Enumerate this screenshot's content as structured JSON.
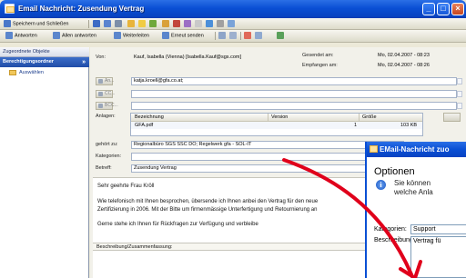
{
  "window": {
    "title": "Email Nachricht: Zusendung Vertrag",
    "minimize": "_",
    "maximize": "□",
    "close": "×"
  },
  "toolbar1": {
    "save_close": "Speichern und Schließen"
  },
  "toolbar2": {
    "reply": "Antworten",
    "reply_all": "Allen antworten",
    "forward": "Weiterleiten",
    "resend": "Erneut senden"
  },
  "nav": {
    "header": "Zugeordnete Objekte",
    "group": "Berechtigungsordner",
    "group_chevron": "»",
    "item": "Auswählen"
  },
  "header": {
    "from_label": "Von:",
    "from_value": "Kauf, Isabella (Vienna) [Isabella.Kauf@sgs.com]",
    "sent_label": "Gesendet am:",
    "sent_value": "Mo, 02.04.2007 - 08:23",
    "received_label": "Empfangen am:",
    "received_value": "Mo, 02.04.2007 - 08:26",
    "to_btn": "An...",
    "to_value": "katja.kroell@gfa.co.at;",
    "cc_btn": "CC...",
    "bcc_btn": "BCC..."
  },
  "attachments": {
    "label": "Anlagen:",
    "col_name": "Bezeichnung",
    "col_version": "Version",
    "col_size": "Größe",
    "row_name": "GFA.pdf",
    "row_version": "1",
    "row_size": "103 KB"
  },
  "meta": {
    "belongs_label": "gehört zu:",
    "belongs_value": "Regionalbüro SGS SSC DO; Regelwerk gfa - SOL-IT",
    "categories_label": "Kategorien:",
    "subject_label": "Betreff:",
    "subject_value": "Zusendung Vertrag"
  },
  "body": {
    "greeting": "Sehr geehrte Frau Kröll",
    "line1": "Wie telefonisch mit Ihnen besprochen, übersende ich Ihnen anbei den Vertrag für den neue",
    "line2": "Zertifizierung in 2006. Mit der Bitte um firmenmässige Unterfertigung und Retournierung an",
    "line3": "Gerne stehe ich Ihnen für Rückfragen zur Verfügung und verbleibe",
    "desc_label": "Beschreibung/Zusammenfassung:"
  },
  "dialog": {
    "title": "EMail-Nachricht zuo",
    "heading": "Optionen",
    "info_icon_glyph": "i",
    "info_line1": "Sie können",
    "info_line2": "welche Anla",
    "categories_label": "Kategorien:",
    "categories_value": "Support",
    "description_label": "Beschreibung:",
    "description_value": "Vertrag fü"
  },
  "colors": {
    "titlebar": "#0a4fd4",
    "nav_group": "#2c5bb8",
    "arrow": "#e0001b"
  },
  "icons": {
    "app": "email-icon",
    "info": "info-icon",
    "folder": "folder-icon"
  }
}
